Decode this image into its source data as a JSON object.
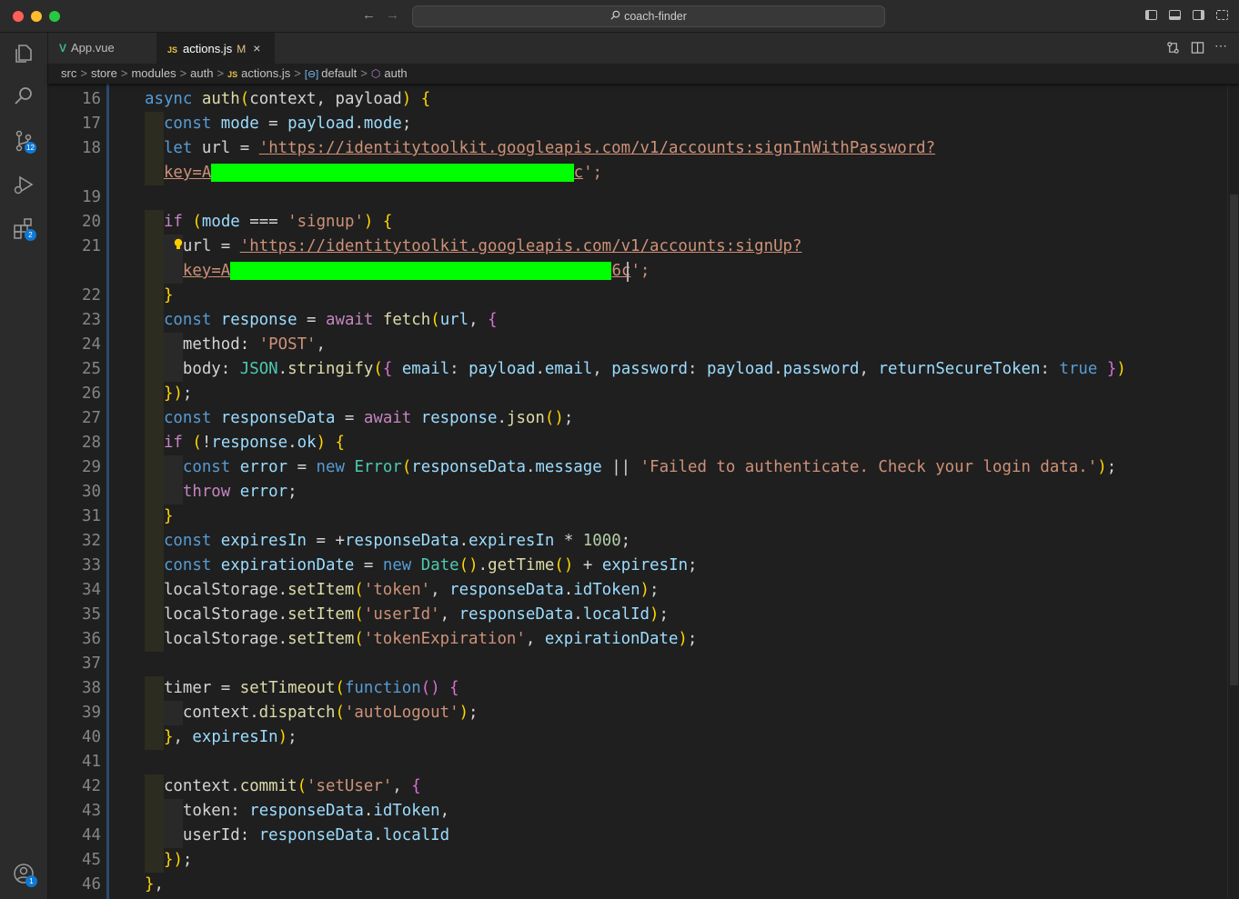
{
  "window": {
    "search_text": "coach-finder"
  },
  "activity_bar": {
    "explorer_icon": "files-icon",
    "search_icon": "search-icon",
    "scm_icon": "source-control-icon",
    "scm_badge": "12",
    "debug_icon": "run-debug-icon",
    "extensions_icon": "extensions-icon",
    "extensions_badge": "2",
    "account_icon": "account-icon",
    "account_badge": "1"
  },
  "tabs": [
    {
      "label": "App.vue",
      "logo": "V",
      "active": false
    },
    {
      "label": "actions.js",
      "logo": "JS",
      "modified": "M",
      "close": "×",
      "active": true
    }
  ],
  "breadcrumb": {
    "parts": [
      "src",
      "store",
      "modules",
      "auth"
    ],
    "file": "actions.js",
    "file_logo": "JS",
    "symbol1": "default",
    "symbol2": "auth",
    "separator": ">"
  },
  "code": {
    "lines": [
      {
        "n": "16",
        "text": "async auth(context, payload) {"
      },
      {
        "n": "17",
        "text": "  const mode = payload.mode;"
      },
      {
        "n": "18",
        "text": "  let url = 'https://identitytoolkit.googleapis.com/v1/accounts:signInWithPassword?"
      },
      {
        "n": "",
        "text": "  key=A[redacted]c';"
      },
      {
        "n": "19",
        "text": ""
      },
      {
        "n": "20",
        "text": "  if (mode === 'signup') {"
      },
      {
        "n": "21",
        "text": "    url = 'https://identitytoolkit.googleapis.com/v1/accounts:signUp?"
      },
      {
        "n": "",
        "text": "    key=A[redacted]6c';"
      },
      {
        "n": "22",
        "text": "  }"
      },
      {
        "n": "23",
        "text": "  const response = await fetch(url, {"
      },
      {
        "n": "24",
        "text": "    method: 'POST',"
      },
      {
        "n": "25",
        "text": "    body: JSON.stringify({ email: payload.email, password: payload.password, returnSecureToken: true })"
      },
      {
        "n": "26",
        "text": "  });"
      },
      {
        "n": "27",
        "text": "  const responseData = await response.json();"
      },
      {
        "n": "28",
        "text": "  if (!response.ok) {"
      },
      {
        "n": "29",
        "text": "    const error = new Error(responseData.message || 'Failed to authenticate. Check your login data.');"
      },
      {
        "n": "30",
        "text": "    throw error;"
      },
      {
        "n": "31",
        "text": "  }"
      },
      {
        "n": "32",
        "text": "  const expiresIn = +responseData.expiresIn * 1000;"
      },
      {
        "n": "33",
        "text": "  const expirationDate = new Date().getTime() + expiresIn;"
      },
      {
        "n": "34",
        "text": "  localStorage.setItem('token', responseData.idToken);"
      },
      {
        "n": "35",
        "text": "  localStorage.setItem('userId', responseData.localId);"
      },
      {
        "n": "36",
        "text": "  localStorage.setItem('tokenExpiration', expirationDate);"
      },
      {
        "n": "37",
        "text": ""
      },
      {
        "n": "38",
        "text": "  timer = setTimeout(function() {"
      },
      {
        "n": "39",
        "text": "    context.dispatch('autoLogout');"
      },
      {
        "n": "40",
        "text": "  }, expiresIn);"
      },
      {
        "n": "41",
        "text": ""
      },
      {
        "n": "42",
        "text": "  context.commit('setUser', {"
      },
      {
        "n": "43",
        "text": "    token: responseData.idToken,"
      },
      {
        "n": "44",
        "text": "    userId: responseData.localId"
      },
      {
        "n": "45",
        "text": "  });"
      },
      {
        "n": "46",
        "text": "},"
      }
    ]
  }
}
